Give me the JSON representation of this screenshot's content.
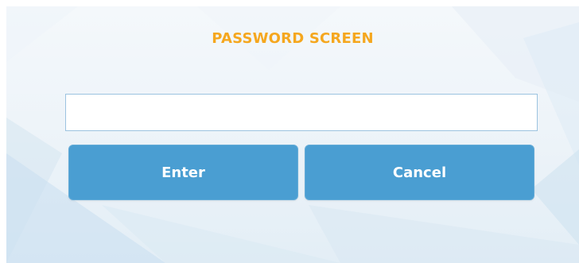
{
  "screen": {
    "title": "PASSWORD SCREEN"
  },
  "password_input": {
    "value": "",
    "placeholder": ""
  },
  "buttons": {
    "enter_label": "Enter",
    "cancel_label": "Cancel"
  },
  "colors": {
    "title": "#f5a71e",
    "button": "#4a9ed2",
    "input_border": "#9cc3e0",
    "background": "#eef4f9"
  }
}
